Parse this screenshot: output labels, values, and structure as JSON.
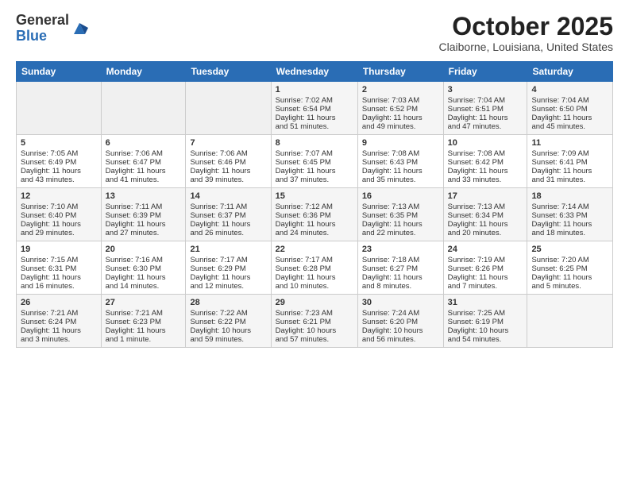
{
  "header": {
    "logo_general": "General",
    "logo_blue": "Blue",
    "month_title": "October 2025",
    "location": "Claiborne, Louisiana, United States"
  },
  "days_of_week": [
    "Sunday",
    "Monday",
    "Tuesday",
    "Wednesday",
    "Thursday",
    "Friday",
    "Saturday"
  ],
  "weeks": [
    [
      {
        "day": "",
        "lines": []
      },
      {
        "day": "",
        "lines": []
      },
      {
        "day": "",
        "lines": []
      },
      {
        "day": "1",
        "lines": [
          "Sunrise: 7:02 AM",
          "Sunset: 6:54 PM",
          "Daylight: 11 hours",
          "and 51 minutes."
        ]
      },
      {
        "day": "2",
        "lines": [
          "Sunrise: 7:03 AM",
          "Sunset: 6:52 PM",
          "Daylight: 11 hours",
          "and 49 minutes."
        ]
      },
      {
        "day": "3",
        "lines": [
          "Sunrise: 7:04 AM",
          "Sunset: 6:51 PM",
          "Daylight: 11 hours",
          "and 47 minutes."
        ]
      },
      {
        "day": "4",
        "lines": [
          "Sunrise: 7:04 AM",
          "Sunset: 6:50 PM",
          "Daylight: 11 hours",
          "and 45 minutes."
        ]
      }
    ],
    [
      {
        "day": "5",
        "lines": [
          "Sunrise: 7:05 AM",
          "Sunset: 6:49 PM",
          "Daylight: 11 hours",
          "and 43 minutes."
        ]
      },
      {
        "day": "6",
        "lines": [
          "Sunrise: 7:06 AM",
          "Sunset: 6:47 PM",
          "Daylight: 11 hours",
          "and 41 minutes."
        ]
      },
      {
        "day": "7",
        "lines": [
          "Sunrise: 7:06 AM",
          "Sunset: 6:46 PM",
          "Daylight: 11 hours",
          "and 39 minutes."
        ]
      },
      {
        "day": "8",
        "lines": [
          "Sunrise: 7:07 AM",
          "Sunset: 6:45 PM",
          "Daylight: 11 hours",
          "and 37 minutes."
        ]
      },
      {
        "day": "9",
        "lines": [
          "Sunrise: 7:08 AM",
          "Sunset: 6:43 PM",
          "Daylight: 11 hours",
          "and 35 minutes."
        ]
      },
      {
        "day": "10",
        "lines": [
          "Sunrise: 7:08 AM",
          "Sunset: 6:42 PM",
          "Daylight: 11 hours",
          "and 33 minutes."
        ]
      },
      {
        "day": "11",
        "lines": [
          "Sunrise: 7:09 AM",
          "Sunset: 6:41 PM",
          "Daylight: 11 hours",
          "and 31 minutes."
        ]
      }
    ],
    [
      {
        "day": "12",
        "lines": [
          "Sunrise: 7:10 AM",
          "Sunset: 6:40 PM",
          "Daylight: 11 hours",
          "and 29 minutes."
        ]
      },
      {
        "day": "13",
        "lines": [
          "Sunrise: 7:11 AM",
          "Sunset: 6:39 PM",
          "Daylight: 11 hours",
          "and 27 minutes."
        ]
      },
      {
        "day": "14",
        "lines": [
          "Sunrise: 7:11 AM",
          "Sunset: 6:37 PM",
          "Daylight: 11 hours",
          "and 26 minutes."
        ]
      },
      {
        "day": "15",
        "lines": [
          "Sunrise: 7:12 AM",
          "Sunset: 6:36 PM",
          "Daylight: 11 hours",
          "and 24 minutes."
        ]
      },
      {
        "day": "16",
        "lines": [
          "Sunrise: 7:13 AM",
          "Sunset: 6:35 PM",
          "Daylight: 11 hours",
          "and 22 minutes."
        ]
      },
      {
        "day": "17",
        "lines": [
          "Sunrise: 7:13 AM",
          "Sunset: 6:34 PM",
          "Daylight: 11 hours",
          "and 20 minutes."
        ]
      },
      {
        "day": "18",
        "lines": [
          "Sunrise: 7:14 AM",
          "Sunset: 6:33 PM",
          "Daylight: 11 hours",
          "and 18 minutes."
        ]
      }
    ],
    [
      {
        "day": "19",
        "lines": [
          "Sunrise: 7:15 AM",
          "Sunset: 6:31 PM",
          "Daylight: 11 hours",
          "and 16 minutes."
        ]
      },
      {
        "day": "20",
        "lines": [
          "Sunrise: 7:16 AM",
          "Sunset: 6:30 PM",
          "Daylight: 11 hours",
          "and 14 minutes."
        ]
      },
      {
        "day": "21",
        "lines": [
          "Sunrise: 7:17 AM",
          "Sunset: 6:29 PM",
          "Daylight: 11 hours",
          "and 12 minutes."
        ]
      },
      {
        "day": "22",
        "lines": [
          "Sunrise: 7:17 AM",
          "Sunset: 6:28 PM",
          "Daylight: 11 hours",
          "and 10 minutes."
        ]
      },
      {
        "day": "23",
        "lines": [
          "Sunrise: 7:18 AM",
          "Sunset: 6:27 PM",
          "Daylight: 11 hours",
          "and 8 minutes."
        ]
      },
      {
        "day": "24",
        "lines": [
          "Sunrise: 7:19 AM",
          "Sunset: 6:26 PM",
          "Daylight: 11 hours",
          "and 7 minutes."
        ]
      },
      {
        "day": "25",
        "lines": [
          "Sunrise: 7:20 AM",
          "Sunset: 6:25 PM",
          "Daylight: 11 hours",
          "and 5 minutes."
        ]
      }
    ],
    [
      {
        "day": "26",
        "lines": [
          "Sunrise: 7:21 AM",
          "Sunset: 6:24 PM",
          "Daylight: 11 hours",
          "and 3 minutes."
        ]
      },
      {
        "day": "27",
        "lines": [
          "Sunrise: 7:21 AM",
          "Sunset: 6:23 PM",
          "Daylight: 11 hours",
          "and 1 minute."
        ]
      },
      {
        "day": "28",
        "lines": [
          "Sunrise: 7:22 AM",
          "Sunset: 6:22 PM",
          "Daylight: 10 hours",
          "and 59 minutes."
        ]
      },
      {
        "day": "29",
        "lines": [
          "Sunrise: 7:23 AM",
          "Sunset: 6:21 PM",
          "Daylight: 10 hours",
          "and 57 minutes."
        ]
      },
      {
        "day": "30",
        "lines": [
          "Sunrise: 7:24 AM",
          "Sunset: 6:20 PM",
          "Daylight: 10 hours",
          "and 56 minutes."
        ]
      },
      {
        "day": "31",
        "lines": [
          "Sunrise: 7:25 AM",
          "Sunset: 6:19 PM",
          "Daylight: 10 hours",
          "and 54 minutes."
        ]
      },
      {
        "day": "",
        "lines": []
      }
    ]
  ]
}
